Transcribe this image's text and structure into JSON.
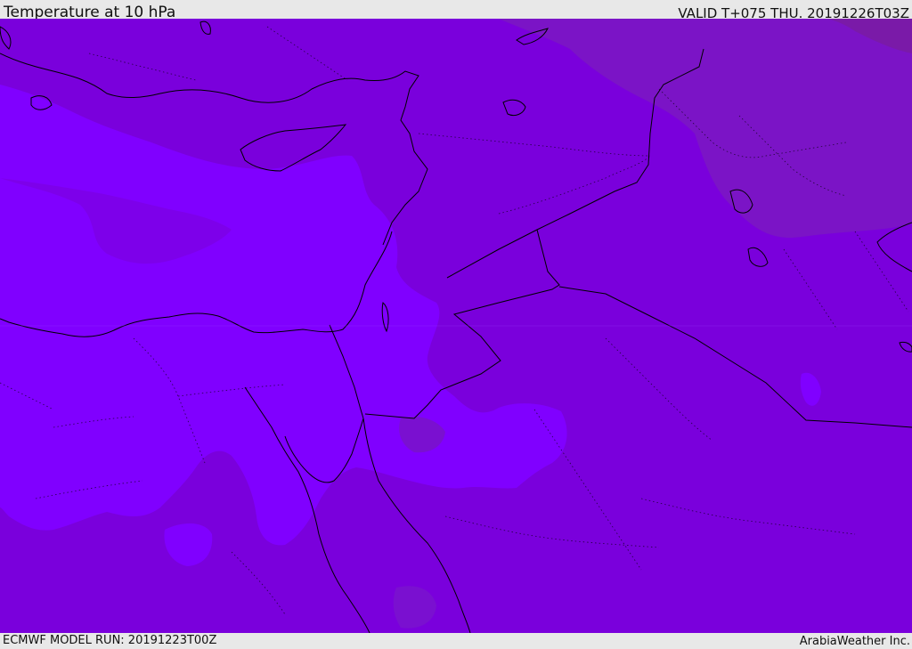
{
  "header": {
    "title": "Temperature at 10 hPa",
    "valid": "VALID T+075 THU. 20191226T03Z"
  },
  "footer": {
    "model_run": "ECMWF MODEL RUN: 20191223T00Z",
    "credit": "ArabiaWeather Inc."
  },
  "map": {
    "region": "Eastern Mediterranean and Middle East",
    "field_colors": {
      "base": "#7a00dc",
      "light": "#8000ff",
      "mid": "#7d00ea",
      "dark": "#7b14c6",
      "darkest": "#7a1aa8"
    },
    "border_color": "#000000"
  }
}
